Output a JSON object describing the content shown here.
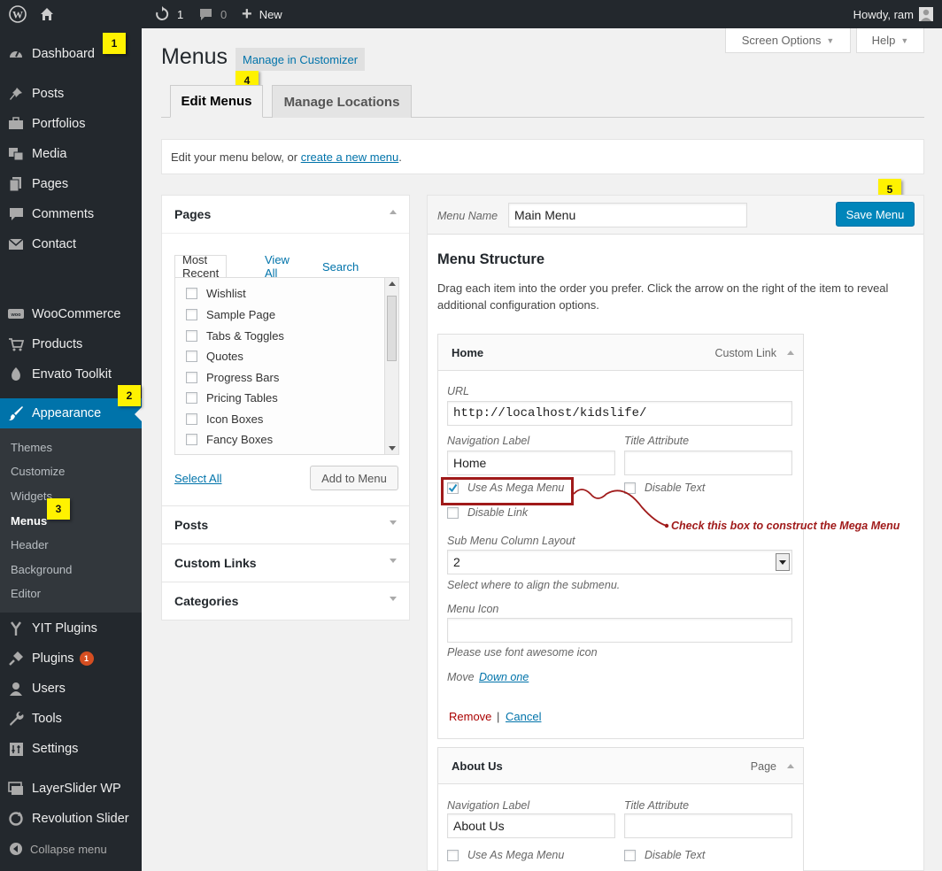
{
  "admin_bar": {
    "updates_count": "1",
    "comments_count": "0",
    "new_label": "New",
    "greeting": "Howdy, ram"
  },
  "sidebar": {
    "items": [
      {
        "label": "Dashboard",
        "icon": "dashboard-icon"
      },
      {
        "label": "Posts",
        "icon": "pin-icon"
      },
      {
        "label": "Portfolios",
        "icon": "briefcase-icon"
      },
      {
        "label": "Media",
        "icon": "media-icon"
      },
      {
        "label": "Pages",
        "icon": "pages-icon"
      },
      {
        "label": "Comments",
        "icon": "comment-icon"
      },
      {
        "label": "Contact",
        "icon": "mail-icon"
      },
      {
        "label": "WooCommerce",
        "icon": "woo-icon"
      },
      {
        "label": "Products",
        "icon": "cart-icon"
      },
      {
        "label": "Envato Toolkit",
        "icon": "leaf-icon"
      },
      {
        "label": "Appearance",
        "icon": "brush-icon"
      },
      {
        "label": "YIT Plugins",
        "icon": "yit-icon"
      },
      {
        "label": "Plugins",
        "icon": "plug-icon",
        "badge": "1"
      },
      {
        "label": "Users",
        "icon": "user-icon"
      },
      {
        "label": "Tools",
        "icon": "wrench-icon"
      },
      {
        "label": "Settings",
        "icon": "settings-icon"
      },
      {
        "label": "LayerSlider WP",
        "icon": "layers-icon"
      },
      {
        "label": "Revolution Slider",
        "icon": "refresh-icon"
      },
      {
        "label": "Collapse menu",
        "icon": "collapse-icon"
      }
    ],
    "submenu": [
      "Themes",
      "Customize",
      "Widgets",
      "Menus",
      "Header",
      "Background",
      "Editor"
    ]
  },
  "callouts": [
    "1",
    "2",
    "3",
    "4",
    "5"
  ],
  "header": {
    "screen_options": "Screen Options",
    "help": "Help",
    "title": "Menus",
    "customizer_btn": "Manage in Customizer",
    "tabs": [
      "Edit Menus",
      "Manage Locations"
    ]
  },
  "notice": {
    "prefix": "Edit your menu below, or ",
    "link": "create a new menu",
    "suffix": "."
  },
  "pages_panel": {
    "title": "Pages",
    "tabs": [
      "Most Recent",
      "View All",
      "Search"
    ],
    "items": [
      "Wishlist",
      "Sample Page",
      "Tabs & Toggles",
      "Quotes",
      "Progress Bars",
      "Pricing Tables",
      "Icon Boxes",
      "Fancy Boxes"
    ],
    "select_all": "Select All",
    "add_to_menu": "Add to Menu"
  },
  "accordion": [
    "Posts",
    "Custom Links",
    "Categories"
  ],
  "menu_edit": {
    "menu_name_label": "Menu Name",
    "menu_name_value": "Main Menu",
    "save_button": "Save Menu",
    "structure_title": "Menu Structure",
    "structure_desc": "Drag each item into the order you prefer. Click the arrow on the right of the item to reveal additional configuration options."
  },
  "home_item": {
    "title": "Home",
    "type": "Custom Link",
    "url_label": "URL",
    "url_value": "http://localhost/kidslife/",
    "nav_label": "Navigation Label",
    "nav_value": "Home",
    "title_attr_label": "Title Attribute",
    "title_attr_value": "",
    "mega_menu_label": "Use As Mega Menu",
    "mega_menu_checked": true,
    "disable_text_label": "Disable Text",
    "disable_link_label": "Disable Link",
    "column_layout_label": "Sub Menu Column Layout",
    "column_layout_value": "2",
    "align_hint": "Select where to align the submenu.",
    "menu_icon_label": "Menu Icon",
    "menu_icon_value": "",
    "icon_hint": "Please use font awesome icon",
    "move_label": "Move",
    "move_link": "Down one",
    "remove": "Remove",
    "separator": "|",
    "cancel": "Cancel"
  },
  "annotation": "Check this box to construct the Mega Menu",
  "about_item": {
    "title": "About Us",
    "type": "Page",
    "nav_label": "Navigation Label",
    "nav_value": "About Us",
    "title_attr_label": "Title Attribute",
    "mega_menu_label": "Use As Mega Menu",
    "disable_text_label": "Disable Text"
  },
  "colors": {
    "sidebar_bg": "#23282d",
    "active_blue": "#0073aa",
    "callout_yellow": "#fff200",
    "annotation_red": "#a01a1a"
  }
}
